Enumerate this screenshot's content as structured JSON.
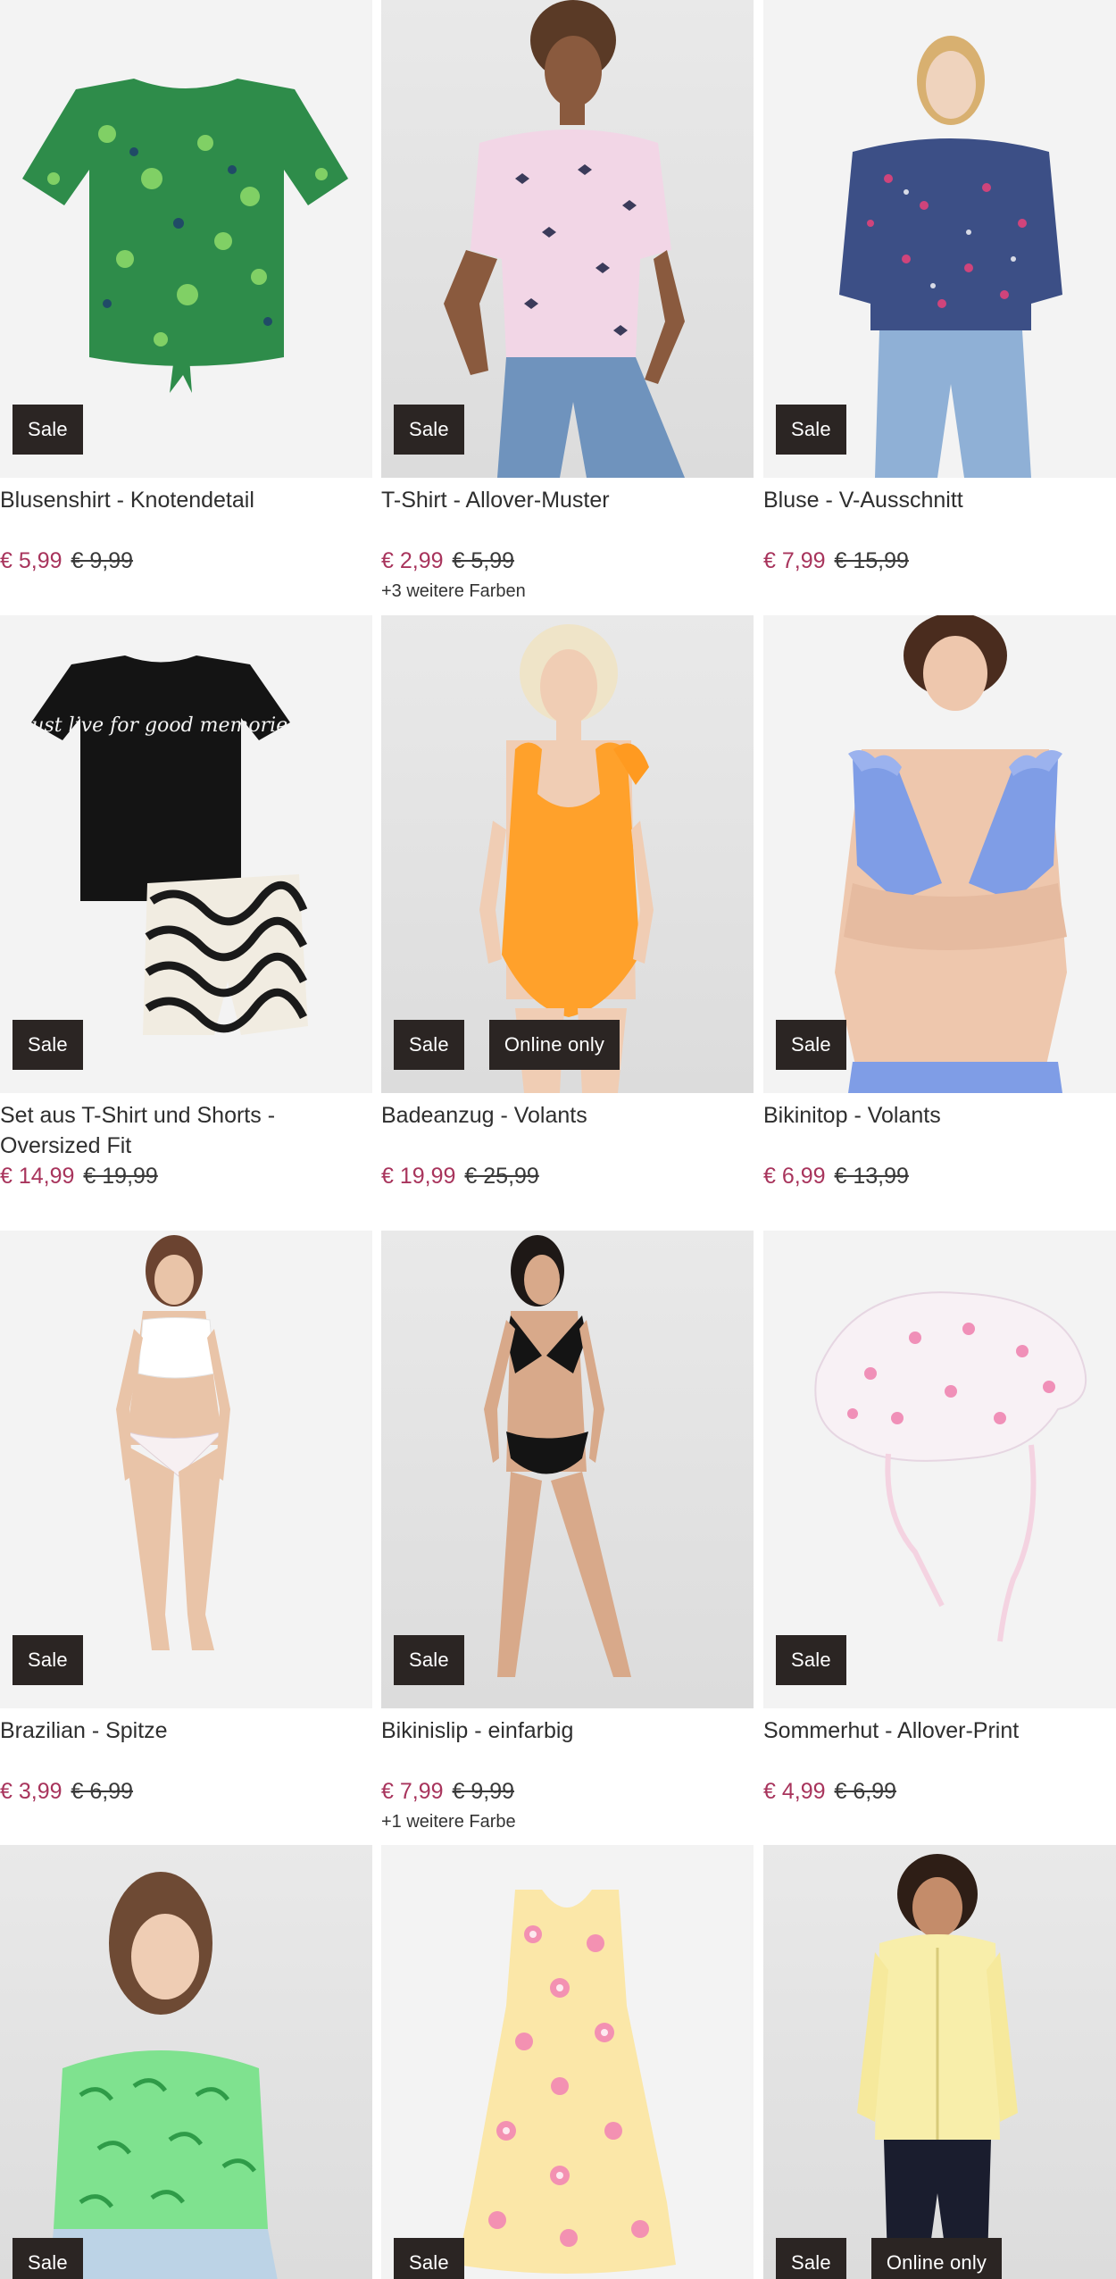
{
  "products": [
    {
      "title": "Blusenshirt - Knotendetail",
      "price": "€ 5,99",
      "old_price": "€ 9,99",
      "badges": [
        "Sale"
      ],
      "colors": ""
    },
    {
      "title": "T-Shirt - Allover-Muster",
      "price": "€ 2,99",
      "old_price": "€ 5,99",
      "badges": [
        "Sale"
      ],
      "colors": "+3 weitere Farben"
    },
    {
      "title": "Bluse - V-Ausschnitt",
      "price": "€ 7,99",
      "old_price": "€ 15,99",
      "badges": [
        "Sale"
      ],
      "colors": ""
    },
    {
      "title": "Set aus T-Shirt und Shorts - Oversized Fit",
      "price": "€ 14,99",
      "old_price": "€ 19,99",
      "badges": [
        "Sale"
      ],
      "colors": "",
      "print_text": "Just live for good memories"
    },
    {
      "title": "Badeanzug - Volants",
      "price": "€ 19,99",
      "old_price": "€ 25,99",
      "badges": [
        "Sale",
        "Online only"
      ],
      "colors": ""
    },
    {
      "title": "Bikinitop - Volants",
      "price": "€ 6,99",
      "old_price": "€ 13,99",
      "badges": [
        "Sale"
      ],
      "colors": ""
    },
    {
      "title": "Brazilian - Spitze",
      "price": "€ 3,99",
      "old_price": "€ 6,99",
      "badges": [
        "Sale"
      ],
      "colors": ""
    },
    {
      "title": "Bikinislip - einfarbig",
      "price": "€ 7,99",
      "old_price": "€ 9,99",
      "badges": [
        "Sale"
      ],
      "colors": "+1 weitere Farbe"
    },
    {
      "title": "Sommerhut - Allover-Print",
      "price": "€ 4,99",
      "old_price": "€ 6,99",
      "badges": [
        "Sale"
      ],
      "colors": ""
    },
    {
      "title": "",
      "price": "",
      "old_price": "",
      "badges": [
        "Sale"
      ],
      "colors": ""
    },
    {
      "title": "",
      "price": "",
      "old_price": "",
      "badges": [
        "Sale"
      ],
      "colors": ""
    },
    {
      "title": "",
      "price": "",
      "old_price": "",
      "badges": [
        "Sale",
        "Online only"
      ],
      "colors": ""
    }
  ],
  "colors": {
    "price_accent": "#a8345c",
    "badge_bg": "#2b2523",
    "badge_text": "#ffffff"
  }
}
